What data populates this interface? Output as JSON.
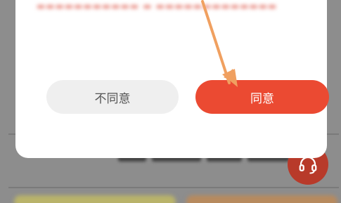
{
  "dialog": {
    "disagree_label": "不同意",
    "agree_label": "同意"
  },
  "colors": {
    "agree_button": "#eb4a32",
    "disagree_button": "#efefef",
    "overlay": "#8d8d8d",
    "annotation_arrow": "#f0a060",
    "service_fab": "#b83a2a"
  },
  "icons": {
    "service_fab": "headset-icon",
    "annotation": "arrow-icon"
  }
}
